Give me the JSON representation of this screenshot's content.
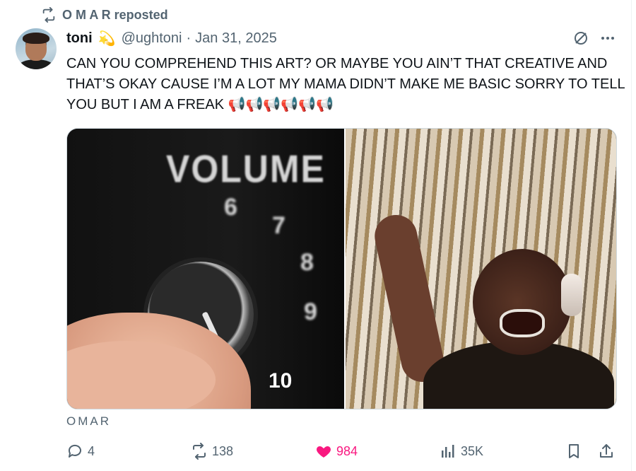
{
  "repost": {
    "label": "O M A R reposted"
  },
  "post": {
    "display_name": "toni",
    "badge": "💫",
    "handle": "@ughtoni",
    "separator": "·",
    "date": "Jan 31, 2025",
    "text": "CAN YOU COMPREHEND THIS ART? OR MAYBE YOU AIN’T THAT CREATIVE AND THAT’S OKAY CAUSE I’M A LOT MY MAMA DIDN’T MAKE ME BASIC SORRY TO TELL YOU BUT I AM A FREAK 📢📢📢📢📢📢",
    "media": {
      "left_word": "VOLUME",
      "dial_numbers": [
        "6",
        "7",
        "8",
        "9",
        "10"
      ]
    },
    "attribution": "OMAR",
    "stats": {
      "replies": "4",
      "reposts": "138",
      "likes": "984",
      "views": "35K"
    }
  },
  "icons": {
    "repost": "repost-icon",
    "grok": "grok-icon",
    "more": "more-icon",
    "reply": "reply-icon",
    "like": "heart-filled-icon",
    "views": "analytics-icon",
    "bookmark": "bookmark-icon",
    "share": "share-icon"
  },
  "colors": {
    "secondary_text": "#536471",
    "like_active": "#f91880",
    "border": "#cfd9de"
  }
}
